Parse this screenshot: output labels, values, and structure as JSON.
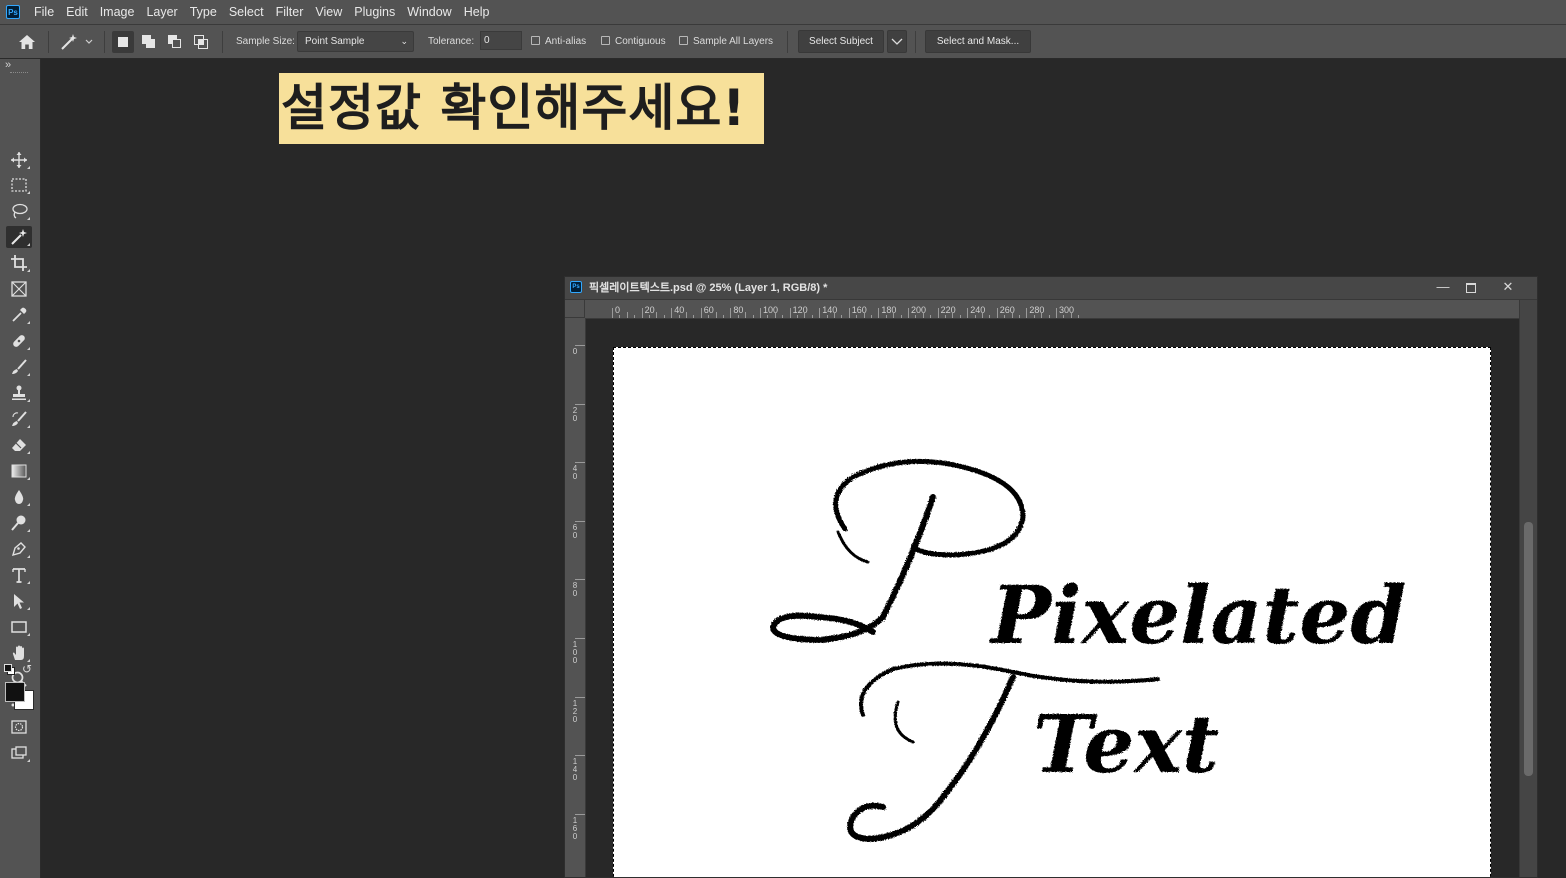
{
  "menubar": {
    "app_icon": "Ps",
    "items": [
      "File",
      "Edit",
      "Image",
      "Layer",
      "Type",
      "Select",
      "Filter",
      "View",
      "Plugins",
      "Window",
      "Help"
    ]
  },
  "options": {
    "sample_size_label": "Sample Size:",
    "sample_size_value": "Point Sample",
    "tolerance_label": "Tolerance:",
    "tolerance_value": "0",
    "anti_alias": "Anti-alias",
    "contiguous": "Contiguous",
    "sample_all_layers": "Sample All Layers",
    "select_subject": "Select Subject",
    "select_and_mask": "Select and Mask..."
  },
  "tools": [
    "move-tool",
    "marquee-tool",
    "lasso-tool",
    "magic-wand-tool",
    "crop-tool",
    "frame-tool",
    "eyedropper-tool",
    "healing-brush-tool",
    "brush-tool",
    "clone-stamp-tool",
    "history-brush-tool",
    "eraser-tool",
    "gradient-tool",
    "blur-tool",
    "dodge-tool",
    "pen-tool",
    "type-tool",
    "path-selection-tool",
    "rectangle-tool",
    "hand-tool",
    "zoom-tool",
    "more-tools"
  ],
  "active_tool": "magic-wand-tool",
  "colors": {
    "foreground": "#111111",
    "background": "#ffffff",
    "banner": "#f7e09a"
  },
  "banner_text": "설정값 확인해주세요!",
  "document": {
    "app_icon": "Ps",
    "title": "픽셀레이트텍스트.psd @ 25% (Layer 1, RGB/8) *",
    "ruler_h": [
      "0",
      "20",
      "40",
      "60",
      "80",
      "100",
      "120",
      "140",
      "160",
      "180",
      "200",
      "220",
      "240",
      "260",
      "280",
      "300"
    ],
    "ruler_v": [
      "0",
      "20",
      "40",
      "60",
      "80",
      "100",
      "120",
      "140",
      "160"
    ],
    "canvas_text_line1": "Pixelated",
    "canvas_text_line2": "Text"
  }
}
